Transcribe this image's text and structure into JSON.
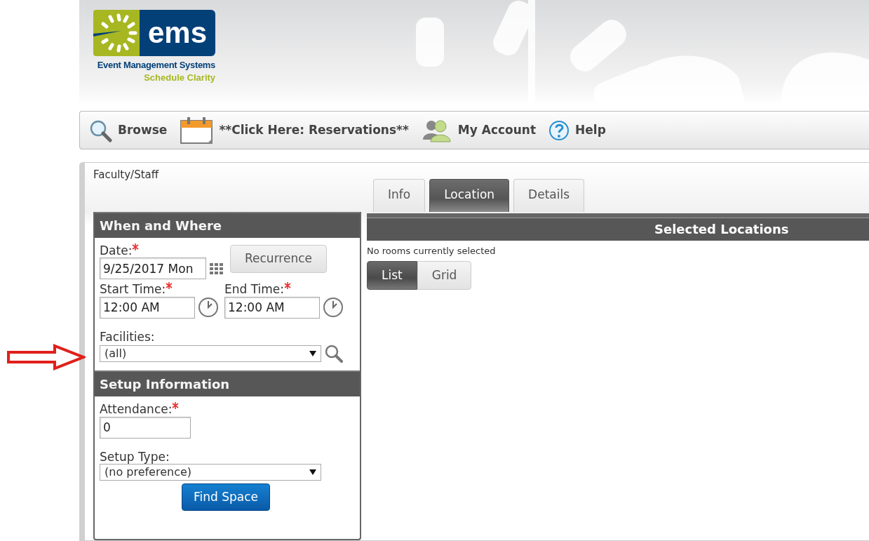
{
  "logo": {
    "mark": "ems",
    "line_1": "Event Management Systems",
    "line_2": "Schedule Clarity"
  },
  "toolbar": [
    {
      "kind": "search",
      "label": "Browse"
    },
    {
      "kind": "calendar",
      "label": "**Click Here: Reservations**"
    },
    {
      "kind": "people",
      "label": "My Account"
    },
    {
      "kind": "help",
      "label": "Help"
    }
  ],
  "breadcrumb": "Faculty/Staff",
  "when_where": {
    "title": "When and Where",
    "date": {
      "label": "Date:",
      "required": true,
      "value": "9/25/2017 Mon"
    },
    "recurrence_button": "Recurrence",
    "start_time": {
      "label": "Start Time:",
      "required": true,
      "value": "12:00 AM"
    },
    "end_time": {
      "label": "End Time:",
      "required": true,
      "value": "12:00 AM"
    },
    "facilities": {
      "label": "Facilities:",
      "value": "(all)"
    }
  },
  "setup": {
    "title": "Setup Information",
    "attendance": {
      "label": "Attendance:",
      "required": true,
      "value": "0"
    },
    "setup_type": {
      "label": "Setup Type:",
      "value": "(no preference)"
    },
    "find_button": "Find Space"
  },
  "tabs": [
    {
      "label": "Info",
      "selected": false
    },
    {
      "label": "Location",
      "selected": true
    },
    {
      "label": "Details",
      "selected": false
    }
  ],
  "selected_locations": {
    "title": "Selected Locations",
    "empty_text": "No rooms currently selected",
    "views": [
      {
        "label": "List",
        "selected": true
      },
      {
        "label": "Grid",
        "selected": false
      }
    ]
  }
}
